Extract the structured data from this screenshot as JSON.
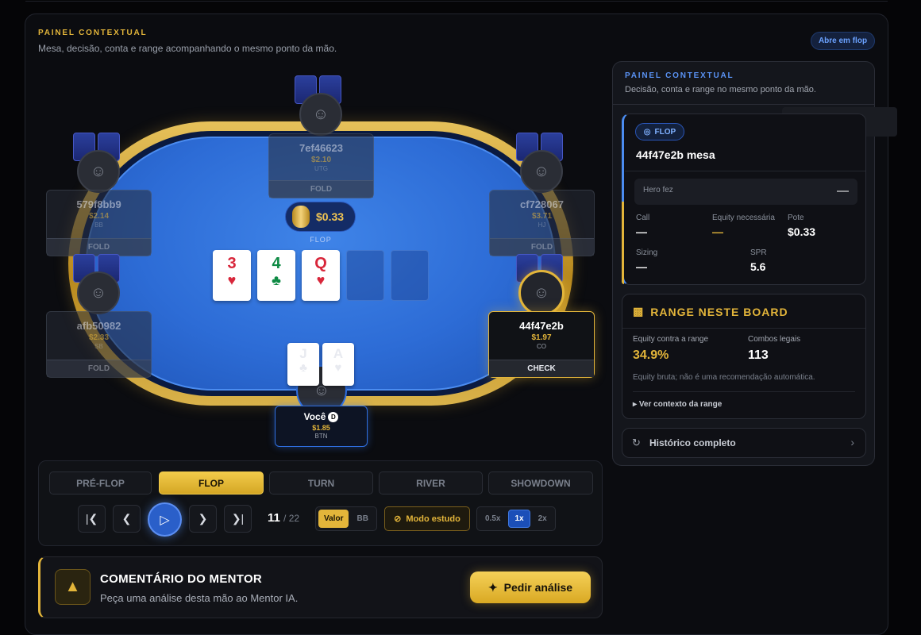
{
  "header": {
    "label": "PAINEL CONTEXTUAL",
    "subtitle": "Mesa, decisão, conta e range acompanhando o mesmo ponto da mão.",
    "open_flop": "Abre em flop"
  },
  "table": {
    "seats": [
      {
        "name": "7ef46623",
        "stack": "$2.10",
        "position": "UTG",
        "action": "FOLD"
      },
      {
        "name": "579f8bb9",
        "stack": "$2.14",
        "position": "BB",
        "action": "FOLD"
      },
      {
        "name": "cf728067",
        "stack": "$3.71",
        "position": "HJ",
        "action": "FOLD"
      },
      {
        "name": "afb50982",
        "stack": "$2.33",
        "position": "SB",
        "action": "FOLD"
      },
      {
        "name": "44f47e2b",
        "stack": "$1.97",
        "position": "CO",
        "action": "CHECK"
      }
    ],
    "hero": {
      "name": "Você",
      "dealer": "D",
      "stack": "$1.85",
      "position": "BTN",
      "cards": [
        {
          "rank": "J",
          "suit": "♣"
        },
        {
          "rank": "A",
          "suit": "♥"
        }
      ]
    },
    "pot": "$0.33",
    "street": "FLOP",
    "board": [
      {
        "rank": "3",
        "suit": "♥"
      },
      {
        "rank": "4",
        "suit": "♣"
      },
      {
        "rank": "Q",
        "suit": "♥"
      }
    ]
  },
  "controls": {
    "streets": [
      "PRÉ-FLOP",
      "FLOP",
      "TURN",
      "RIVER",
      "SHOWDOWN"
    ],
    "active_street": "FLOP",
    "step": "11",
    "step_total": "/ 22",
    "unit_value": "Valor",
    "unit_bb": "BB",
    "study_mode": "Modo estudo",
    "speeds": [
      "0.5x",
      "1x",
      "2x"
    ],
    "active_speed": "1x"
  },
  "mentor": {
    "title": "COMENTÁRIO DO MENTOR",
    "subtitle": "Peça uma análise desta mão ao Mentor IA.",
    "button": "Pedir análise"
  },
  "panel": {
    "title": "PAINEL CONTEXTUAL",
    "subtitle": "Decisão, conta e range no mesmo ponto da mão.",
    "decision": {
      "badge": "FLOP",
      "table_name": "44f47e2b mesa",
      "hero_did_label": "Hero fez",
      "hero_did_value": "—",
      "call_label": "Call",
      "call_value": "—",
      "equity_needed_label": "Equity necessária",
      "equity_needed_value": "—",
      "pot_label": "Pote",
      "pot_value": "$0.33",
      "sizing_label": "Sizing",
      "sizing_value": "—",
      "spr_label": "SPR",
      "spr_value": "5.6"
    },
    "range": {
      "title": "RANGE NESTE BOARD",
      "equity_label": "Equity contra a range",
      "equity_value": "34.9%",
      "combos_label": "Combos legais",
      "combos_value": "113",
      "note": "Equity bruta; não é uma recomendação automática.",
      "more": "Ver contexto da range"
    },
    "history": "Histórico completo"
  },
  "colors": {
    "accent_gold": "#e3b53a",
    "accent_blue": "#4b8cf0",
    "felt": "#2d6cd6",
    "heart": "#d8263a",
    "club": "#0e8a44"
  }
}
